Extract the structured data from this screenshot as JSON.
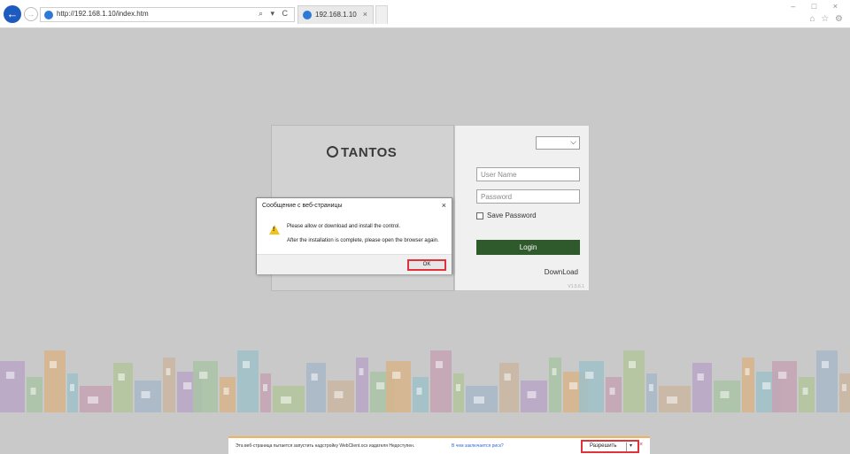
{
  "browser": {
    "url": "http://192.168.1.10/index.htm",
    "address_tools": "⌕ ▾ C",
    "tab_title": "192.168.1.10",
    "tab_close": "×",
    "back_glyph": "←",
    "forward_glyph": "→",
    "window_controls": "– □ ×",
    "toolbar_icons": "⌂ ☆ ⚙"
  },
  "login": {
    "logo_text": "TANTOS",
    "language_chevron": "⌵",
    "username_placeholder": "User Name",
    "password_placeholder": "Password",
    "save_password_label": "Save Password",
    "login_label": "Login",
    "download_label": "DownLoad",
    "version": "V1.5.6.1"
  },
  "dialog": {
    "title": "Сообщение с веб-страницы",
    "close": "×",
    "message_line1": "Please allow or download and install the control.",
    "message_line2": "After the installation is complete, please open the browser again.",
    "ok_label": "OK",
    "warning_glyph": "!"
  },
  "infobar": {
    "message": "Эта веб-страница пытается запустить надстройку WebClient.ocx издателя Недоступен.",
    "risk_link": "В чем заключается риск?",
    "allow_label": "Разрешить",
    "allow_dropdown": "▾",
    "close": "×"
  },
  "colors": {
    "login_button": "#2f5a2c",
    "highlight": "#e0323a",
    "warning": "#f2c21c",
    "infobar_border": "#f0b25b"
  }
}
